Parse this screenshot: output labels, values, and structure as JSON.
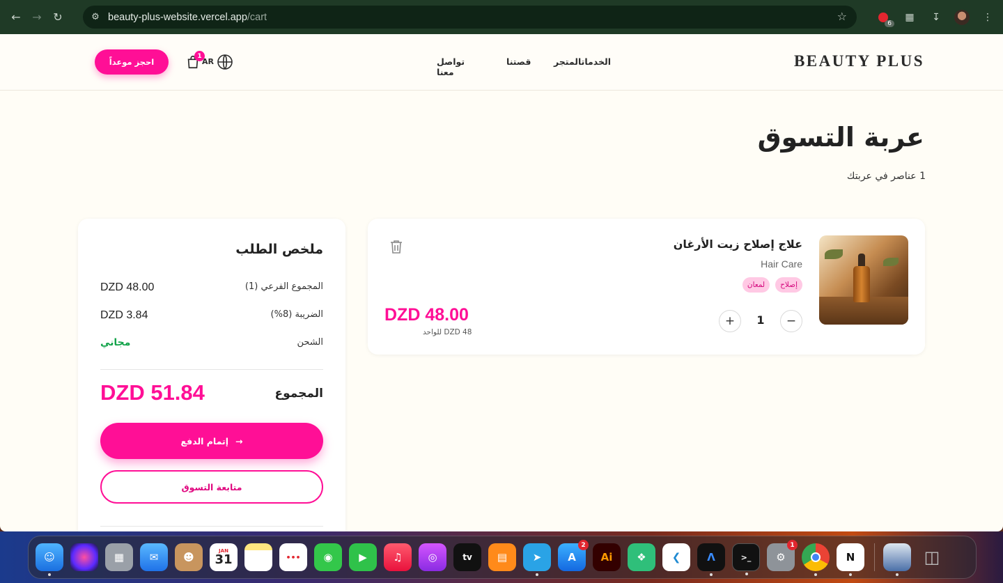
{
  "browser": {
    "url_host": "beauty-plus-website.vercel.app",
    "url_path": "/cart",
    "extension_badge": "6"
  },
  "header": {
    "logo": "BEAUTY PLUS",
    "nav": [
      "المتجر",
      "الخدمات",
      "قصتنا",
      "تواصل معنا"
    ],
    "lang": "AR",
    "cart_count": "1",
    "book_button": "احجز موعداً"
  },
  "cart": {
    "title": "عربة التسوق",
    "item_count": "1 عناصر في عربتك",
    "items": [
      {
        "name": "علاج إصلاح زيت الأرغان",
        "category": "Hair Care",
        "tags": [
          "إصلاح",
          "لمعان"
        ],
        "quantity": "1",
        "line_total": "DZD 48.00",
        "unit_price": "DZD 48 للواحد"
      }
    ]
  },
  "summary": {
    "title": "ملخص الطلب",
    "subtotal_label": "المجموع الفرعي (1)",
    "subtotal_value": "DZD 48.00",
    "tax_label": "الضريبة (8%)",
    "tax_value": "DZD 3.84",
    "shipping_label": "الشحن",
    "shipping_value": "مجاني",
    "total_label": "المجموع",
    "total_value": "DZD 51.84",
    "checkout_button": "إتمام الدفع",
    "continue_button": "متابعة التسوق"
  },
  "dock": {
    "calendar_month": "JAN",
    "calendar_day": "31",
    "tv_label": "tv",
    "illustrator_label": "Ai",
    "appstore_badge": "2",
    "settings_badge": "1"
  },
  "colors": {
    "accent": "#ff0f96",
    "free_shipping": "#13a34a",
    "page_bg": "#fffdf6",
    "chrome_bg": "#1f3a26"
  }
}
